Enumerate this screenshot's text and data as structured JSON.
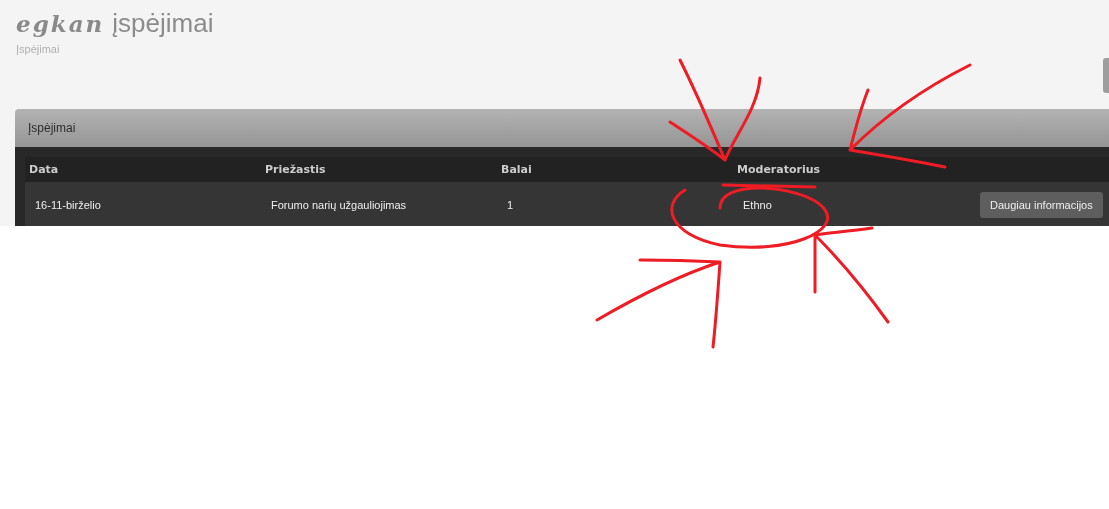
{
  "header": {
    "logo": "egkan",
    "title": "įspėjimai",
    "breadcrumb": "Įspėjimai"
  },
  "panel": {
    "title": "Įspėjimai",
    "table": {
      "columns": [
        "Data",
        "Priežastis",
        "Balai",
        "Moderatorius"
      ],
      "rows": [
        {
          "cells": [
            "16-11-birželio",
            "Forumo narių užgauliojimas",
            "1",
            "Ethno"
          ],
          "button": "Daugiau informacijos"
        }
      ]
    }
  }
}
